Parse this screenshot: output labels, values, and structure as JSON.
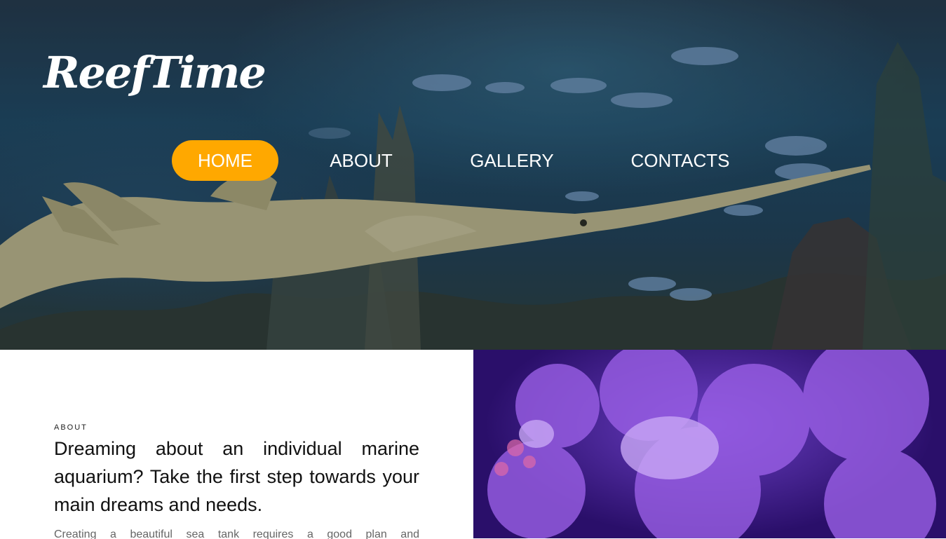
{
  "header": {
    "logo_text": "ReefTime"
  },
  "nav": {
    "items": [
      {
        "label": "HOME",
        "active": true
      },
      {
        "label": "ABOUT",
        "active": false
      },
      {
        "label": "GALLERY",
        "active": false
      },
      {
        "label": "CONTACTS",
        "active": false
      }
    ]
  },
  "about": {
    "eyebrow": "ABOUT",
    "title": "Dreaming about an individual marine aquarium? Take the first step towards your main dreams and needs.",
    "text": "Creating a beautiful sea tank requires a good plan and"
  },
  "colors": {
    "accent": "#ffa800",
    "hero_water": "#1e4660",
    "coral_purple": "#6b3fc4"
  }
}
